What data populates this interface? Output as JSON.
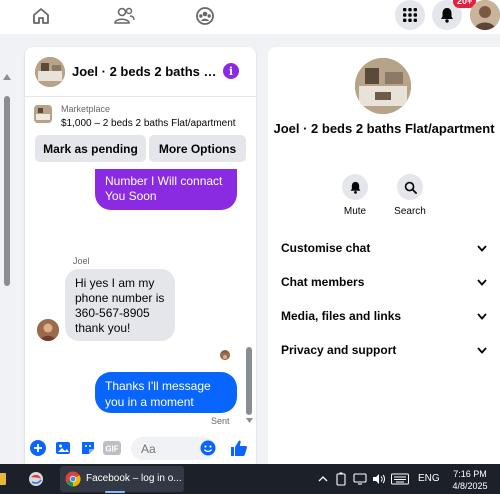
{
  "topnav": {
    "icons": [
      "home-icon",
      "friends-icon",
      "groups-icon",
      "menu-grid-icon",
      "bell-icon"
    ],
    "notif_count": "20+"
  },
  "chat": {
    "title": "Joel · 2 beds 2 baths Flat/apartment",
    "marketplace_label": "Marketplace",
    "listing": "$1,000 – 2 beds 2 baths Flat/apartment",
    "mark_pending": "Mark as pending",
    "more_options": "More Options",
    "messages": [
      {
        "from": "me",
        "text": "Number I Will connact You Soon"
      },
      {
        "from": "Joel",
        "sender": "Joel",
        "text": "Hi yes I am my phone number is 360-567-8905 thank you!"
      },
      {
        "from": "me",
        "text": "Thanks I'll message you in a moment"
      }
    ],
    "sent_label": "Sent",
    "input_placeholder": "Aa"
  },
  "details": {
    "title": "Joel · 2 beds 2 baths Flat/apartment",
    "actions": [
      {
        "label": "Mute",
        "icon": "bell-icon"
      },
      {
        "label": "Search",
        "icon": "search-icon"
      }
    ],
    "sections": [
      "Customise chat",
      "Chat members",
      "Media, files and links",
      "Privacy and support"
    ]
  },
  "taskbar": {
    "window_title": "Facebook – log in o...",
    "language": "ENG",
    "time": "7:16 PM",
    "date": "4/8/2025"
  },
  "colors": {
    "messenger_purple": "#8a2be2",
    "messenger_blue": "#0866ff",
    "badge_red": "#e41e3f"
  }
}
